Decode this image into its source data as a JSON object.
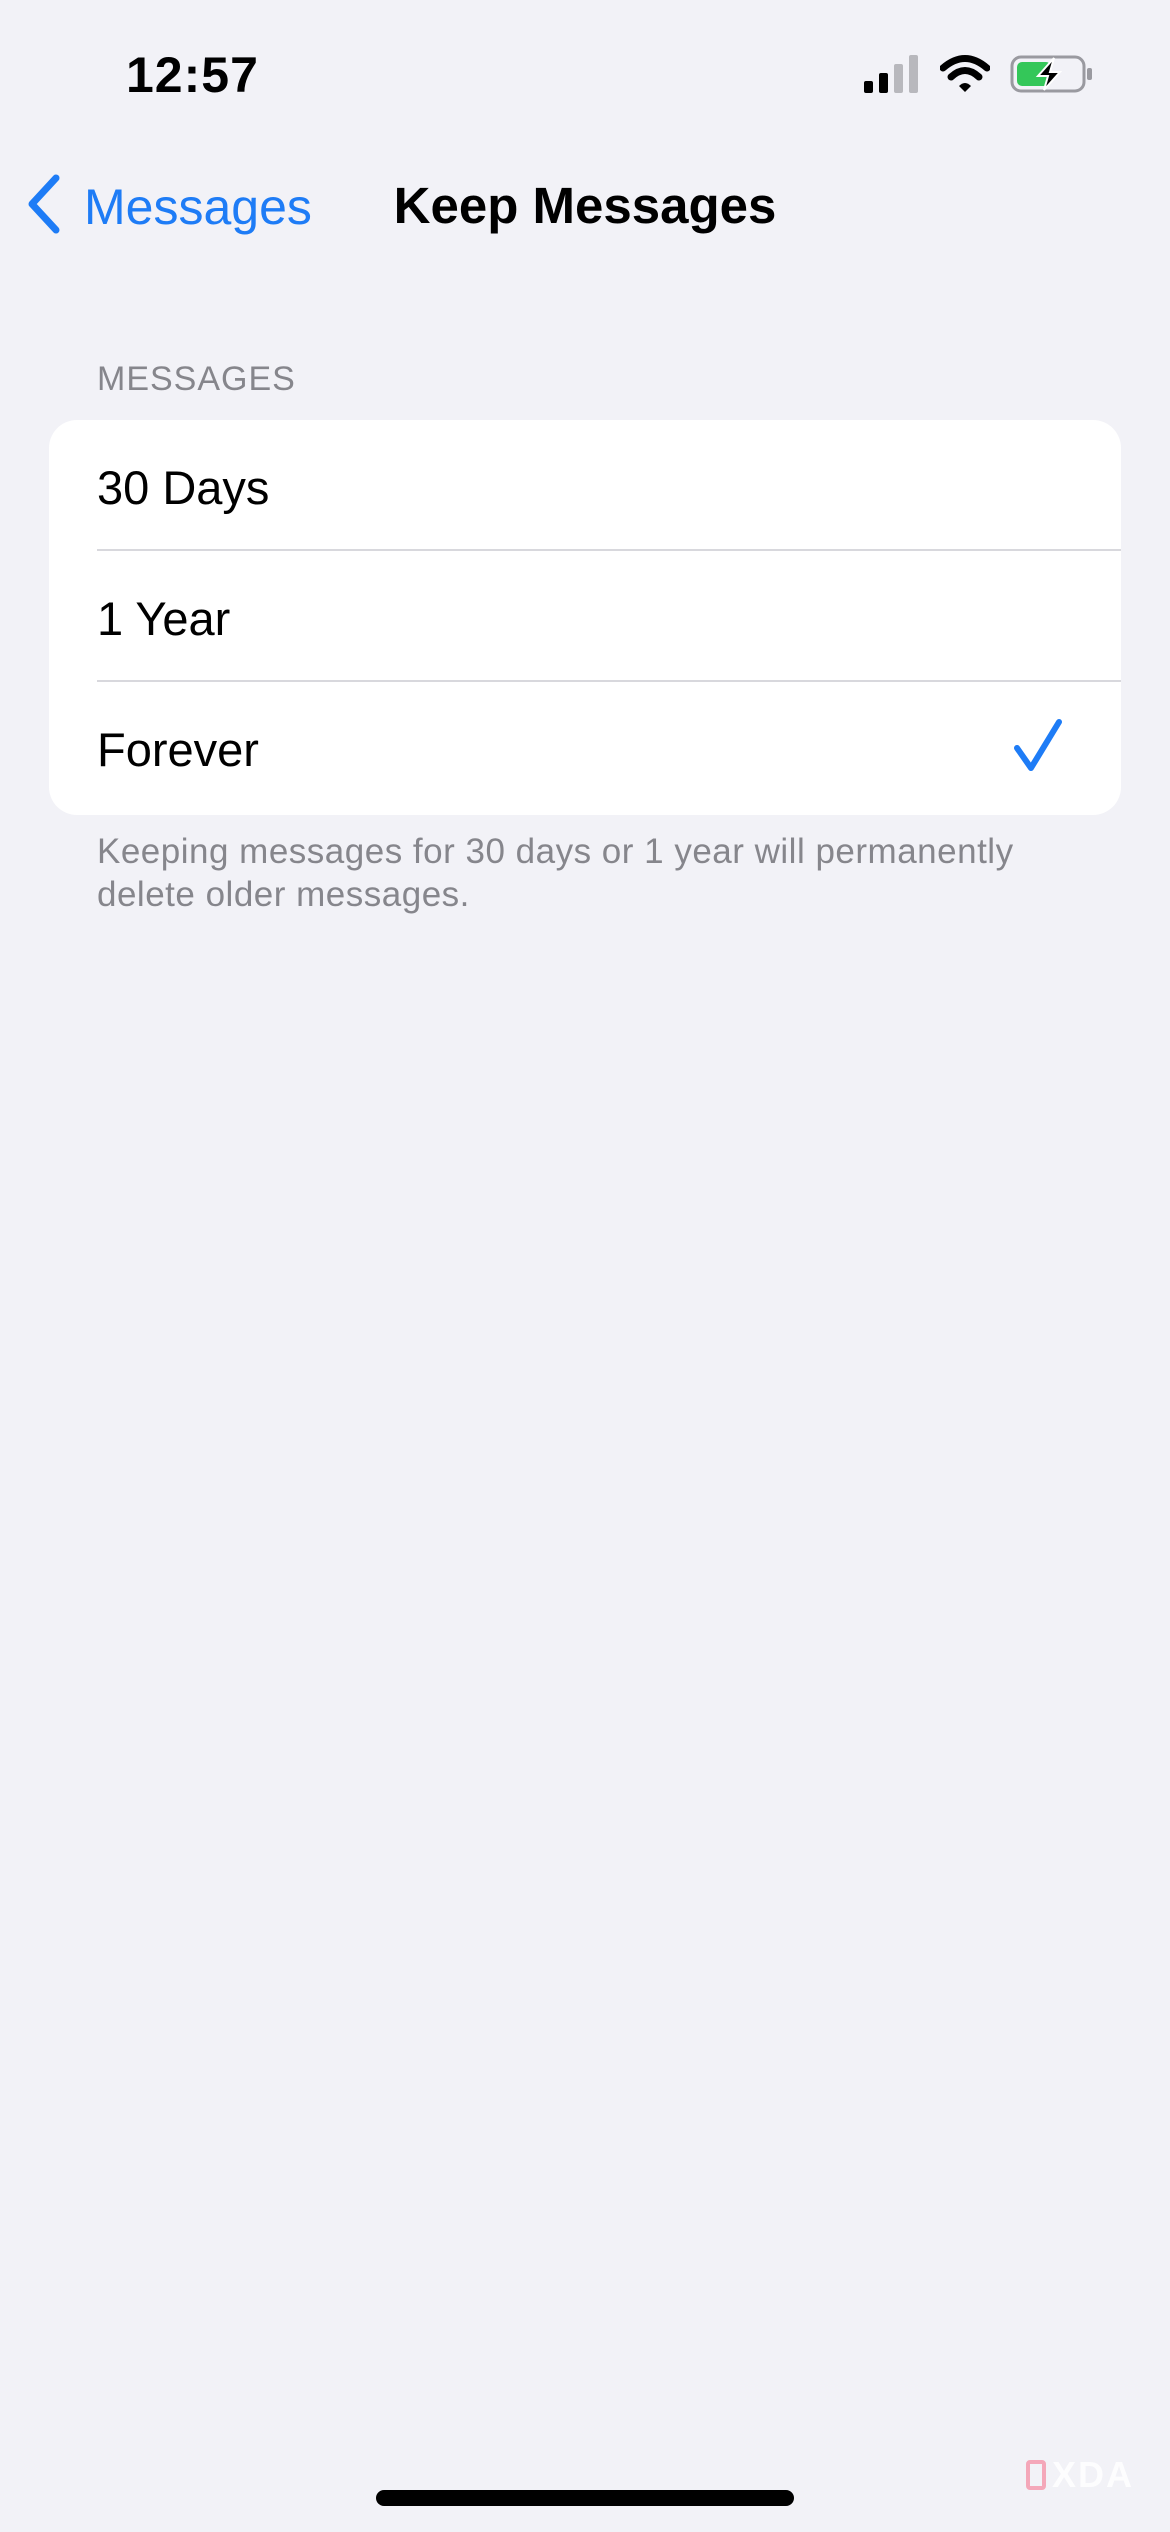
{
  "status_bar": {
    "time": "12:57",
    "icons": [
      "cellular-signal-icon",
      "wifi-icon",
      "battery-charging-icon"
    ],
    "battery_color": "#34c759"
  },
  "nav": {
    "back_label": "Messages",
    "title": "Keep Messages",
    "accent_color": "#1e7cf6"
  },
  "section": {
    "header": "MESSAGES",
    "options": [
      {
        "label": "30 Days",
        "selected": false
      },
      {
        "label": "1 Year",
        "selected": false
      },
      {
        "label": "Forever",
        "selected": true
      }
    ],
    "footer": "Keeping messages for 30 days or 1 year will permanently delete older messages."
  },
  "watermark": {
    "text": "XDA"
  }
}
